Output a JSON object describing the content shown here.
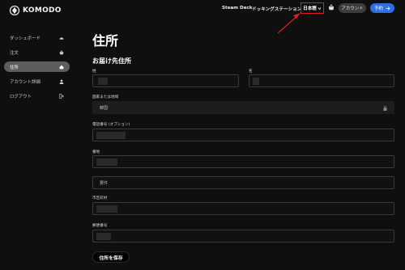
{
  "header": {
    "logo_text": "KOMODO",
    "nav": [
      "Steam Deck",
      "ドッキングステーション"
    ],
    "language": "日本語",
    "account_button": "アカウント",
    "reserve_button": "予約",
    "highlight_color": "#e31b1b",
    "accent_color": "#2f6fe6"
  },
  "sidebar": {
    "items": [
      {
        "label": "ダッシュボード",
        "icon": "speedometer-icon"
      },
      {
        "label": "注文",
        "icon": "basket-icon"
      },
      {
        "label": "住所",
        "icon": "home-icon",
        "active": true
      },
      {
        "label": "アカウント詳細",
        "icon": "user-icon"
      },
      {
        "label": "ログアウト",
        "icon": "logout-icon"
      }
    ]
  },
  "main": {
    "title": "住所",
    "section_title": "お届け先住所",
    "fields": {
      "last_name_label": "姓",
      "first_name_label": "名",
      "country_label": "国家または地域",
      "country_value": "韓国",
      "phone_label": "電話番号 (オプション)",
      "address_label": "番地",
      "apartment_placeholder": "要件",
      "city_label": "市区町村",
      "postal_label": "郵便番号"
    },
    "save_button": "住所を保存"
  }
}
